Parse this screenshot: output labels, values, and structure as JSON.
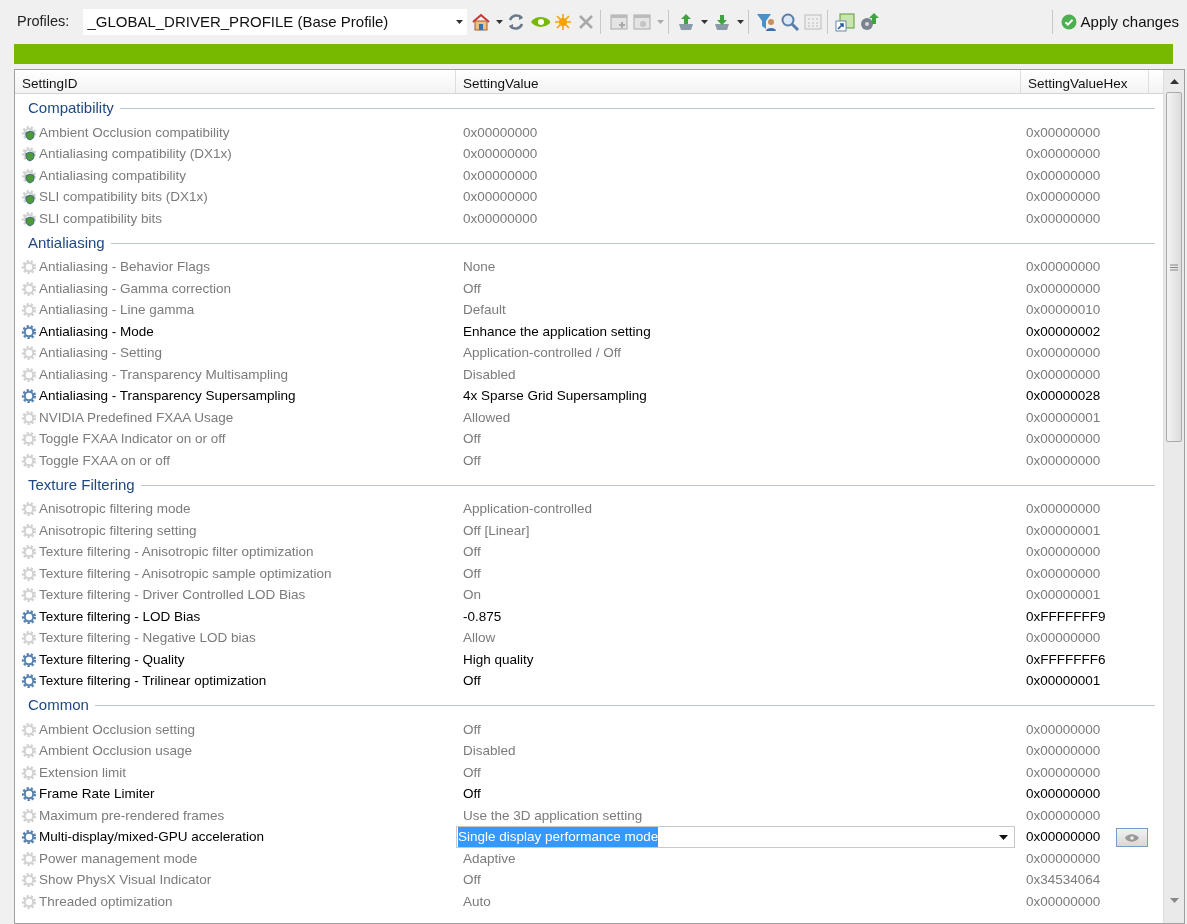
{
  "toolbar": {
    "profiles_label": "Profiles:",
    "profile": "_GLOBAL_DRIVER_PROFILE (Base Profile)",
    "apply_label": "Apply changes"
  },
  "table": {
    "columns": [
      "SettingID",
      "SettingValue",
      "SettingValueHex"
    ],
    "groups": [
      {
        "title": "Compatibility",
        "rows": [
          {
            "kind": "compat",
            "modified": false,
            "selected": false,
            "name": "Ambient Occlusion compatibility",
            "value": "0x00000000",
            "hex": "0x00000000"
          },
          {
            "kind": "compat",
            "modified": false,
            "selected": false,
            "name": "Antialiasing compatibility (DX1x)",
            "value": "0x00000000",
            "hex": "0x00000000"
          },
          {
            "kind": "compat",
            "modified": false,
            "selected": false,
            "name": "Antialiasing compatibility",
            "value": "0x00000000",
            "hex": "0x00000000"
          },
          {
            "kind": "compat",
            "modified": false,
            "selected": false,
            "name": "SLI compatibility bits (DX1x)",
            "value": "0x00000000",
            "hex": "0x00000000"
          },
          {
            "kind": "compat",
            "modified": false,
            "selected": false,
            "name": "SLI compatibility bits",
            "value": "0x00000000",
            "hex": "0x00000000"
          }
        ]
      },
      {
        "title": "Antialiasing",
        "rows": [
          {
            "kind": "setting",
            "modified": false,
            "selected": false,
            "name": "Antialiasing - Behavior Flags",
            "value": "None",
            "hex": "0x00000000"
          },
          {
            "kind": "setting",
            "modified": false,
            "selected": false,
            "name": "Antialiasing - Gamma correction",
            "value": "Off",
            "hex": "0x00000000"
          },
          {
            "kind": "setting",
            "modified": false,
            "selected": false,
            "name": "Antialiasing - Line gamma",
            "value": "Default",
            "hex": "0x00000010"
          },
          {
            "kind": "setting",
            "modified": true,
            "selected": false,
            "name": "Antialiasing - Mode",
            "value": "Enhance the application setting",
            "hex": "0x00000002"
          },
          {
            "kind": "setting",
            "modified": false,
            "selected": false,
            "name": "Antialiasing - Setting",
            "value": "Application-controlled / Off",
            "hex": "0x00000000"
          },
          {
            "kind": "setting",
            "modified": false,
            "selected": false,
            "name": "Antialiasing - Transparency Multisampling",
            "value": "Disabled",
            "hex": "0x00000000"
          },
          {
            "kind": "setting",
            "modified": true,
            "selected": false,
            "name": "Antialiasing - Transparency Supersampling",
            "value": "4x Sparse Grid Supersampling",
            "hex": "0x00000028"
          },
          {
            "kind": "setting",
            "modified": false,
            "selected": false,
            "name": "NVIDIA Predefined FXAA Usage",
            "value": "Allowed",
            "hex": "0x00000001"
          },
          {
            "kind": "setting",
            "modified": false,
            "selected": false,
            "name": "Toggle FXAA Indicator on or off",
            "value": "Off",
            "hex": "0x00000000"
          },
          {
            "kind": "setting",
            "modified": false,
            "selected": false,
            "name": "Toggle FXAA on or off",
            "value": "Off",
            "hex": "0x00000000"
          }
        ]
      },
      {
        "title": "Texture Filtering",
        "rows": [
          {
            "kind": "setting",
            "modified": false,
            "selected": false,
            "name": "Anisotropic filtering mode",
            "value": "Application-controlled",
            "hex": "0x00000000"
          },
          {
            "kind": "setting",
            "modified": false,
            "selected": false,
            "name": "Anisotropic filtering setting",
            "value": "Off [Linear]",
            "hex": "0x00000001"
          },
          {
            "kind": "setting",
            "modified": false,
            "selected": false,
            "name": "Texture filtering - Anisotropic filter optimization",
            "value": "Off",
            "hex": "0x00000000"
          },
          {
            "kind": "setting",
            "modified": false,
            "selected": false,
            "name": "Texture filtering - Anisotropic sample optimization",
            "value": "Off",
            "hex": "0x00000000"
          },
          {
            "kind": "setting",
            "modified": false,
            "selected": false,
            "name": "Texture filtering - Driver Controlled LOD Bias",
            "value": "On",
            "hex": "0x00000001"
          },
          {
            "kind": "setting",
            "modified": true,
            "selected": false,
            "name": "Texture filtering - LOD Bias",
            "value": "-0.875",
            "hex": "0xFFFFFFF9"
          },
          {
            "kind": "setting",
            "modified": false,
            "selected": false,
            "name": "Texture filtering - Negative LOD bias",
            "value": "Allow",
            "hex": "0x00000000"
          },
          {
            "kind": "setting",
            "modified": true,
            "selected": false,
            "name": "Texture filtering - Quality",
            "value": "High quality",
            "hex": "0xFFFFFFF6"
          },
          {
            "kind": "setting",
            "modified": true,
            "selected": false,
            "name": "Texture filtering - Trilinear optimization",
            "value": "Off",
            "hex": "0x00000001"
          }
        ]
      },
      {
        "title": "Common",
        "rows": [
          {
            "kind": "setting",
            "modified": false,
            "selected": false,
            "name": "Ambient Occlusion setting",
            "value": "Off",
            "hex": "0x00000000"
          },
          {
            "kind": "setting",
            "modified": false,
            "selected": false,
            "name": "Ambient Occlusion usage",
            "value": "Disabled",
            "hex": "0x00000000"
          },
          {
            "kind": "setting",
            "modified": false,
            "selected": false,
            "name": "Extension limit",
            "value": "Off",
            "hex": "0x00000000"
          },
          {
            "kind": "setting",
            "modified": true,
            "selected": false,
            "name": "Frame Rate Limiter",
            "value": "Off",
            "hex": "0x00000000"
          },
          {
            "kind": "setting",
            "modified": false,
            "selected": false,
            "name": "Maximum pre-rendered frames",
            "value": "Use the 3D application setting",
            "hex": "0x00000000"
          },
          {
            "kind": "setting",
            "modified": true,
            "selected": true,
            "name": "Multi-display/mixed-GPU acceleration",
            "value": "Single display performance mode",
            "hex": "0x00000000"
          },
          {
            "kind": "setting",
            "modified": false,
            "selected": false,
            "name": "Power management mode",
            "value": "Adaptive",
            "hex": "0x00000000"
          },
          {
            "kind": "setting",
            "modified": false,
            "selected": false,
            "name": "Show PhysX Visual Indicator",
            "value": "Off",
            "hex": "0x34534064"
          },
          {
            "kind": "setting",
            "modified": false,
            "selected": false,
            "name": "Threaded optimization",
            "value": "Auto",
            "hex": "0x00000000"
          }
        ]
      }
    ]
  }
}
